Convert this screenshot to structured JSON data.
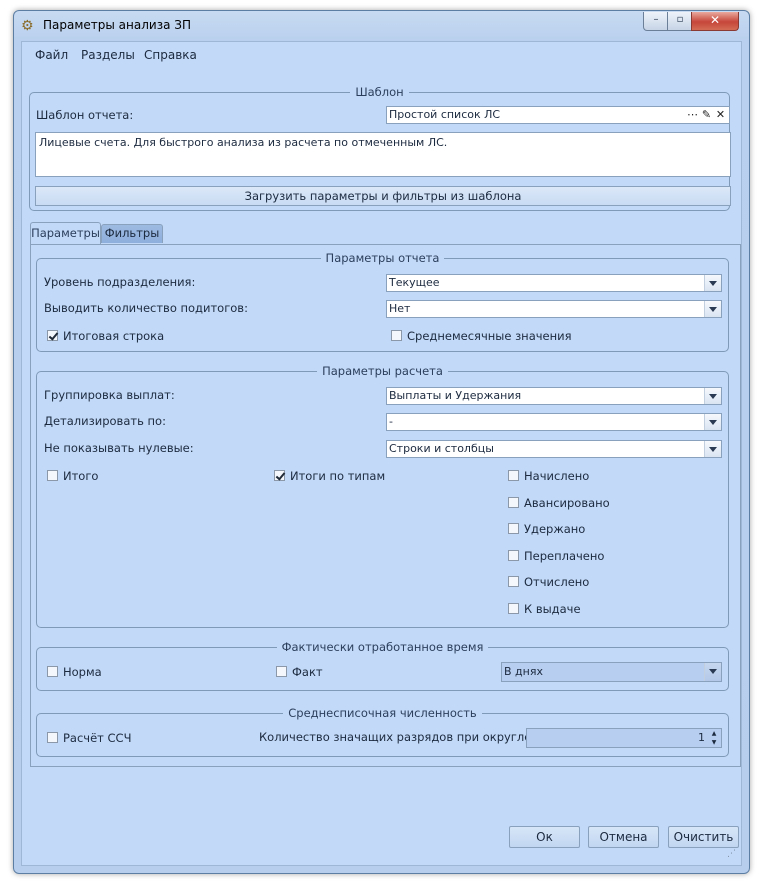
{
  "window": {
    "title": "Параметры анализа ЗП",
    "close_glyph": "✕",
    "max_glyph": "▫",
    "min_glyph": "–"
  },
  "menu": [
    "Файл",
    "Разделы",
    "Справка"
  ],
  "template_group": {
    "title": "Шаблон",
    "template_label": "Шаблон отчета:",
    "template_value": "Простой список ЛС",
    "description": "Лицевые счета. Для быстрого анализа из расчета по отмеченным ЛС.",
    "load_button": "Загрузить параметры и фильтры из шаблона"
  },
  "tabs": [
    "Параметры",
    "Фильтры"
  ],
  "report_params": {
    "title": "Параметры отчета",
    "level_label": "Уровень подразделения:",
    "level_value": "Текущее",
    "subtotals_label": "Выводить количество подитогов:",
    "subtotals_value": "Нет",
    "total_row_label": "Итоговая строка",
    "total_row_checked": true,
    "monthly_avg_label": "Среднемесячные значения",
    "monthly_avg_checked": false
  },
  "calc_params": {
    "title": "Параметры расчета",
    "grouping_label": "Группировка выплат:",
    "grouping_value": "Выплаты и Удержания",
    "detail_label": "Детализировать по:",
    "detail_value": "-",
    "zeros_label": "Не показывать нулевые:",
    "zeros_value": "Строки и столбцы",
    "total_label": "Итого",
    "total_checked": false,
    "type_totals_label": "Итоги по типам",
    "type_totals_checked": true,
    "type_checks": [
      {
        "label": "Начислено",
        "checked": false
      },
      {
        "label": "Авансировано",
        "checked": false
      },
      {
        "label": "Удержано",
        "checked": false
      },
      {
        "label": "Переплачено",
        "checked": false
      },
      {
        "label": "Отчислено",
        "checked": false
      },
      {
        "label": "К выдаче",
        "checked": false
      }
    ]
  },
  "worked_time": {
    "title": "Фактически отработанное время",
    "norm_label": "Норма",
    "fact_label": "Факт",
    "unit_value": "В днях"
  },
  "headcount": {
    "title": "Среднесписочная численность",
    "calc_label": "Расчёт ССЧ",
    "digits_label": "Количество значащих разрядов при округлении:",
    "digits_value": "1"
  },
  "buttons": {
    "ok": "Ок",
    "cancel": "Отмена",
    "clear": "Очистить"
  }
}
